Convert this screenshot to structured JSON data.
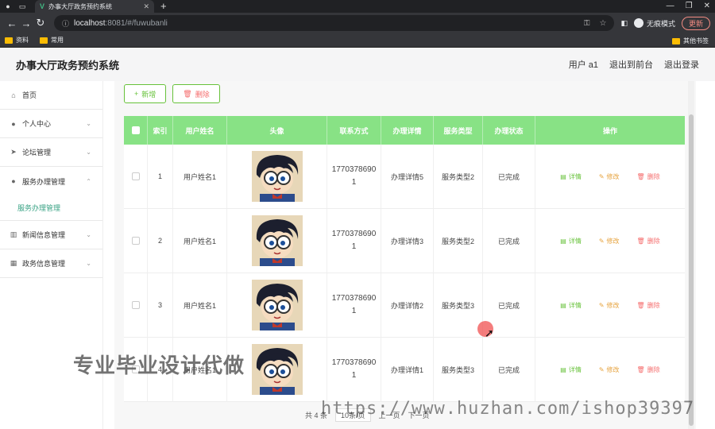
{
  "browser": {
    "tab_title": "办事大厅政务预约系统",
    "new_tab": "+",
    "url_host": "localhost",
    "url_path": ":8081/#/fuwubanli",
    "incognito_label": "无痕模式",
    "update_label": "更新",
    "bookmarks": [
      "资料",
      "常用"
    ],
    "other_bookmarks": "其他书签"
  },
  "header": {
    "title": "办事大厅政务预约系统",
    "user": "用户 a1",
    "back_to_front": "退出到前台",
    "logout": "退出登录"
  },
  "sidebar": {
    "items": [
      {
        "label": "首页",
        "icon": "home-icon"
      },
      {
        "label": "个人中心",
        "icon": "user-icon"
      },
      {
        "label": "论坛管理",
        "icon": "send-icon"
      },
      {
        "label": "服务办理管理",
        "icon": "user-icon"
      },
      {
        "label": "新闻信息管理",
        "icon": "chart-icon"
      },
      {
        "label": "政务信息管理",
        "icon": "grid-icon"
      }
    ],
    "sub_item": "服务办理管理"
  },
  "toolbar": {
    "add_label": "新增",
    "delete_label": "删除"
  },
  "table": {
    "columns": [
      "索引",
      "用户姓名",
      "头像",
      "联系方式",
      "办理详情",
      "服务类型",
      "办理状态",
      "操作"
    ],
    "rows": [
      {
        "index": "1",
        "name": "用户姓名1",
        "phone_a": "1770378690",
        "phone_b": "1",
        "detail": "办理详情5",
        "type": "服务类型2",
        "status": "已完成"
      },
      {
        "index": "2",
        "name": "用户姓名1",
        "phone_a": "1770378690",
        "phone_b": "1",
        "detail": "办理详情3",
        "type": "服务类型2",
        "status": "已完成"
      },
      {
        "index": "3",
        "name": "用户姓名1",
        "phone_a": "1770378690",
        "phone_b": "1",
        "detail": "办理详情2",
        "type": "服务类型3",
        "status": "已完成"
      },
      {
        "index": "4",
        "name": "用户姓名1",
        "phone_a": "1770378690",
        "phone_b": "1",
        "detail": "办理详情1",
        "type": "服务类型3",
        "status": "已完成"
      }
    ],
    "actions": {
      "detail": "详情",
      "edit": "修改",
      "remove": "删除"
    }
  },
  "pagination": {
    "total": "共 4 条",
    "page_size": "10条/页",
    "prev": "上一页",
    "next": "下一页"
  },
  "watermarks": {
    "cn": "专业毕业设计代做",
    "url": "https://www.huzhan.com/ishop39397"
  },
  "colors": {
    "table_header": "#88e285",
    "accent_green": "#67c23a",
    "warn_orange": "#e6a23c",
    "danger_red": "#f56c6c",
    "sidebar_active": "#3aa385"
  }
}
